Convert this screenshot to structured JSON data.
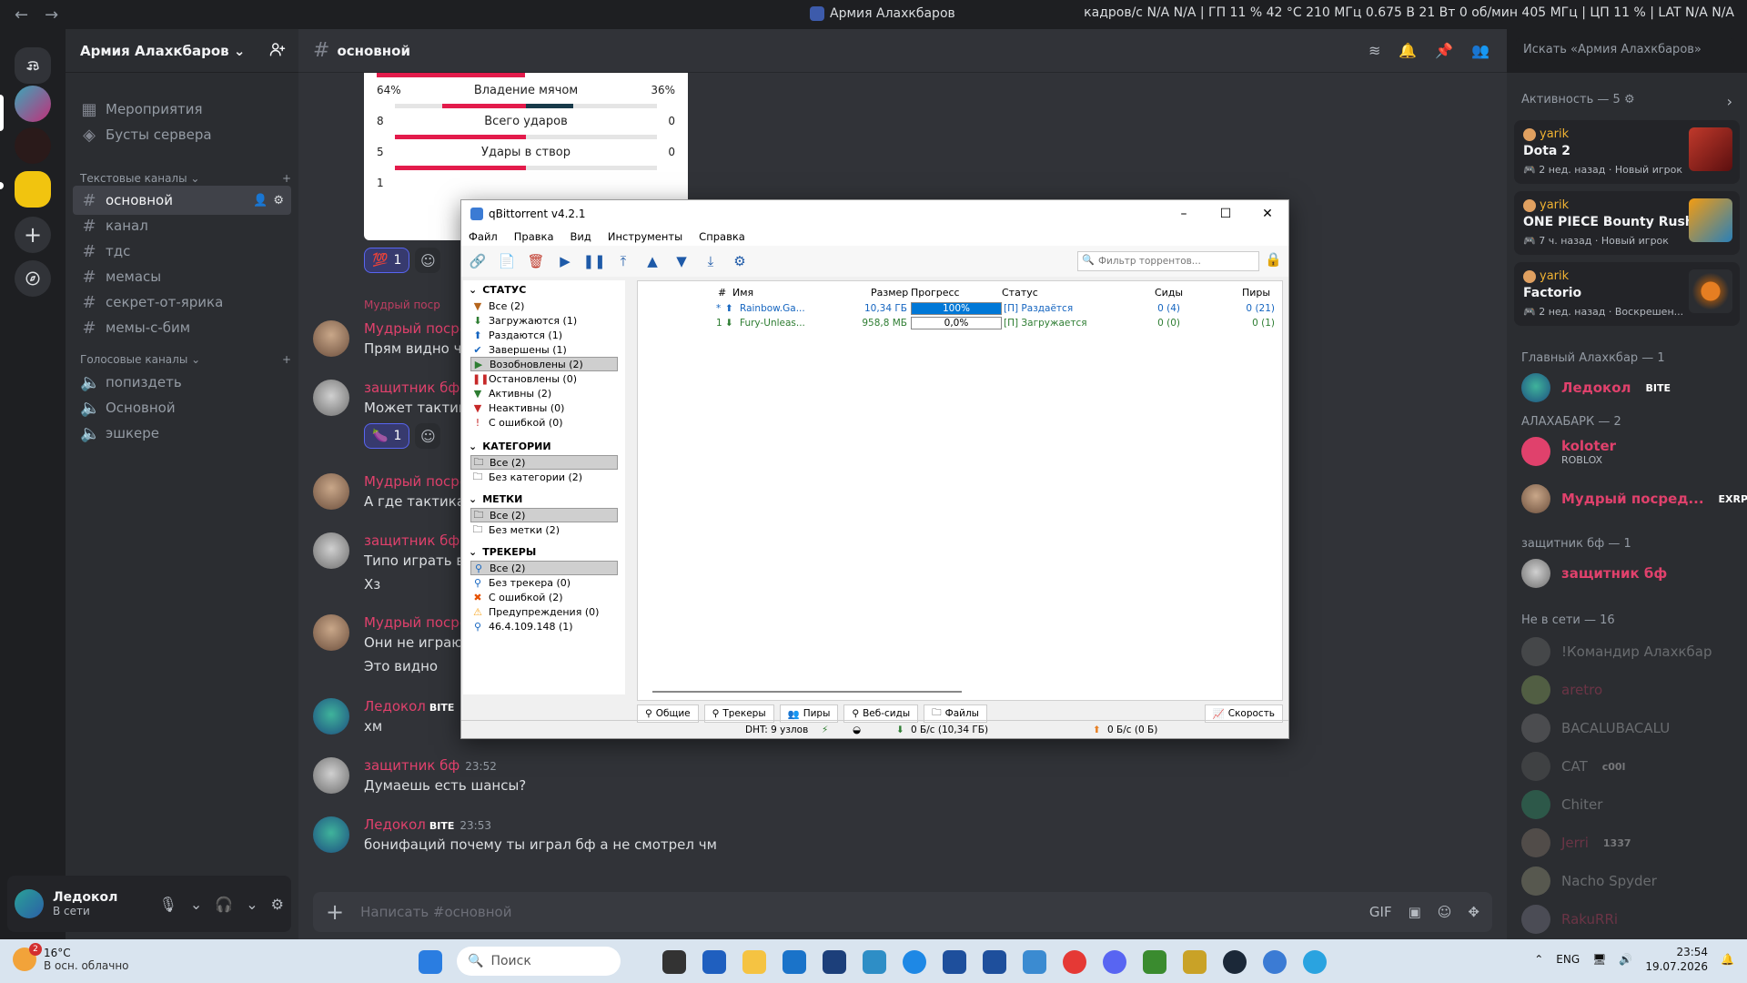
{
  "titlebar": {
    "title": "Армия Алахкбаров",
    "stats": "кадров/с N/A N/A | ГП 11 % 42 °C 210 МГц 0.675 В 21 Вт 0 об/мин 405 МГц | ЦП 11 % | LAT N/A N/A"
  },
  "server": {
    "name": "Армия Алахкбаров",
    "top_items": [
      "Мероприятия",
      "Бусты сервера"
    ],
    "text_category": "Текстовые каналы",
    "text_channels": [
      "основной",
      "канал",
      "тдс",
      "мемасы",
      "секрет-от-ярика",
      "мемы-с-бим"
    ],
    "voice_category": "Голосовые каналы",
    "voice_channels": [
      "попиздеть",
      "Основной",
      "эшкере"
    ]
  },
  "user": {
    "name": "Ледокол",
    "status": "В сети"
  },
  "chat": {
    "channel": "основной",
    "search_placeholder": "Искать «Армия Алахкбаров»",
    "composer_placeholder": "Написать #основной",
    "embed": {
      "rows": [
        {
          "left": "64%",
          "label": "Владение мячом",
          "right": "36%",
          "left_frac": 0.64,
          "right_frac": 0.36
        },
        {
          "left": "8",
          "label": "Всего ударов",
          "right": "0",
          "left_frac": 1.0,
          "right_frac": 0.0
        },
        {
          "left": "5",
          "label": "Удары в створ",
          "right": "0",
          "left_frac": 1.0,
          "right_frac": 0.0
        },
        {
          "left": "1",
          "label": "",
          "right": "",
          "left_frac": 1.0,
          "right_frac": 0.0
        }
      ]
    },
    "reactions": [
      {
        "emoji": "💯",
        "count": "1"
      },
      {
        "emoji": "🍆",
        "count": "1"
      }
    ],
    "messages": [
      {
        "author": "Мудрый посредник",
        "lines": [
          "Прям видно что"
        ]
      },
      {
        "author": "защитник бф",
        "lines": [
          "Может тактика"
        ]
      },
      {
        "author": "Мудрый посредник",
        "lines": [
          "А где тактика в"
        ]
      },
      {
        "author": "защитник бф",
        "lines": [
          "Типо играть в з",
          "Хз"
        ]
      },
      {
        "author": "Мудрый посредник",
        "lines": [
          "Они не играют",
          "Это видно"
        ]
      },
      {
        "author": "Ледокол",
        "badge": "BITE",
        "lines": [
          "хм"
        ]
      },
      {
        "author": "защитник бф",
        "time": "23:52",
        "lines": [
          "Думаешь есть шансы?"
        ]
      },
      {
        "author": "Ледокол",
        "badge": "BITE",
        "time": "23:53",
        "lines": [
          "бонифаций почему ты играл бф а не смотрел чм"
        ]
      }
    ],
    "reply_preview": "Мудрый поср"
  },
  "members": {
    "activity_header": "Активность — 5",
    "activities": [
      {
        "user": "yarik",
        "game": "Dota 2",
        "sub": "2 нед. назад",
        "tag": "Новый игрок"
      },
      {
        "user": "yarik",
        "game": "ONE PIECE Bounty Rush",
        "sub": "7 ч. назад",
        "tag": "Новый игрок"
      },
      {
        "user": "yarik",
        "game": "Factorio",
        "sub": "2 нед. назад",
        "tag": "Воскрешен..."
      }
    ],
    "groups": [
      {
        "header": "Главный Алахкбар — 1",
        "members": [
          {
            "name": "Ледокол",
            "tag": "BITE"
          }
        ]
      },
      {
        "header": "АЛАХАБАРК — 2",
        "members": [
          {
            "name": "koloter",
            "sub": "ROBLOX"
          },
          {
            "name": "Мудрый посред...",
            "tag": "EXRP"
          }
        ]
      },
      {
        "header": "защитник бф — 1",
        "members": [
          {
            "name": "защитник бф"
          }
        ]
      },
      {
        "header": "Не в сети — 16",
        "members": [
          {
            "name": "!Командир Алахкбар"
          },
          {
            "name": "aretro"
          },
          {
            "name": "BACALUBACALU"
          },
          {
            "name": "CAT",
            "tag": "c00l"
          },
          {
            "name": "Chiter"
          },
          {
            "name": "Jerri",
            "tag": "1337"
          },
          {
            "name": "Nacho Spyder"
          },
          {
            "name": "RakuRRi"
          }
        ]
      }
    ]
  },
  "qbittorrent": {
    "title": "qBittorrent v4.2.1",
    "menu": [
      "Файл",
      "Правка",
      "Вид",
      "Инструменты",
      "Справка"
    ],
    "filter_placeholder": "Фильтр торрентов...",
    "sections": {
      "status": {
        "header": "СТАТУС",
        "items": [
          "Все (2)",
          "Загружаются (1)",
          "Раздаются (1)",
          "Завершены (1)",
          "Возобновлены (2)",
          "Остановлены (0)",
          "Активны (2)",
          "Неактивны (0)",
          "С ошибкой (0)"
        ]
      },
      "categories": {
        "header": "КАТЕГОРИИ",
        "items": [
          "Все (2)",
          "Без категории (2)"
        ]
      },
      "tags": {
        "header": "МЕТКИ",
        "items": [
          "Все (2)",
          "Без метки (2)"
        ]
      },
      "trackers": {
        "header": "ТРЕКЕРЫ",
        "items": [
          "Все (2)",
          "Без трекера (0)",
          "С ошибкой (2)",
          "Предупреждения (0)",
          "46.4.109.148 (1)"
        ]
      }
    },
    "columns": [
      "#",
      "Имя",
      "Размер",
      "Прогресс",
      "Статус",
      "Сиды",
      "Пиры"
    ],
    "rows": [
      {
        "num": "*",
        "name": "Rainbow.Ga...",
        "size": "10,34 ГБ",
        "progress": 1.0,
        "progress_text": "100%",
        "status": "[П] Раздаётся",
        "seeds": "0 (4)",
        "peers": "0 (21)"
      },
      {
        "num": "1",
        "name": "Fury-Unleas...",
        "size": "958,8 МБ",
        "progress": 0.0,
        "progress_text": "0,0%",
        "status": "[П] Загружается",
        "seeds": "0 (0)",
        "peers": "0 (1)"
      }
    ],
    "tabs": [
      "Общие",
      "Трекеры",
      "Пиры",
      "Веб-сиды",
      "Файлы"
    ],
    "speed_tab": "Скорость",
    "statusbar": {
      "dht": "DHT: 9 узлов",
      "down": "0 Б/с (10,34 ГБ)",
      "up": "0 Б/с (0 Б)"
    }
  },
  "taskbar": {
    "weather_temp": "16°C",
    "weather_desc": "В осн. облачно",
    "weather_badge": "2",
    "search": "Поиск",
    "lang": "ENG",
    "time": "23:54",
    "date": "19.07.2026"
  },
  "colors": {
    "accent": "#5865f2",
    "role": "#e0416c",
    "qbt_progress": "#0078d7"
  }
}
